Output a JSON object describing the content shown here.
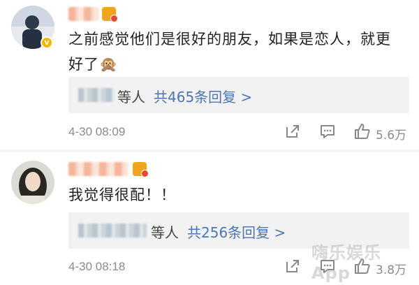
{
  "comments": [
    {
      "text": "之前感觉他们是很好的朋友，如果是恋人，就更好了🙊",
      "replies_who": "等人",
      "replies_more": "共465条回复 >",
      "time": "4-30 08:09",
      "likes": "5.6万",
      "avatar_badge": "v"
    },
    {
      "text": "我觉得很配！！",
      "replies_who": "等人",
      "replies_more": "共256条回复 >",
      "time": "4-30 08:18",
      "likes": "3.8万"
    }
  ],
  "watermark": "嗨乐娱乐App",
  "icons": [
    "share-icon",
    "comment-icon",
    "like-icon",
    "verified-badge-icon",
    "level-badge-icon"
  ],
  "colors": {
    "link": "#4a77b3",
    "reply_bg": "#f2f2f2",
    "badge": "#f7b500"
  }
}
